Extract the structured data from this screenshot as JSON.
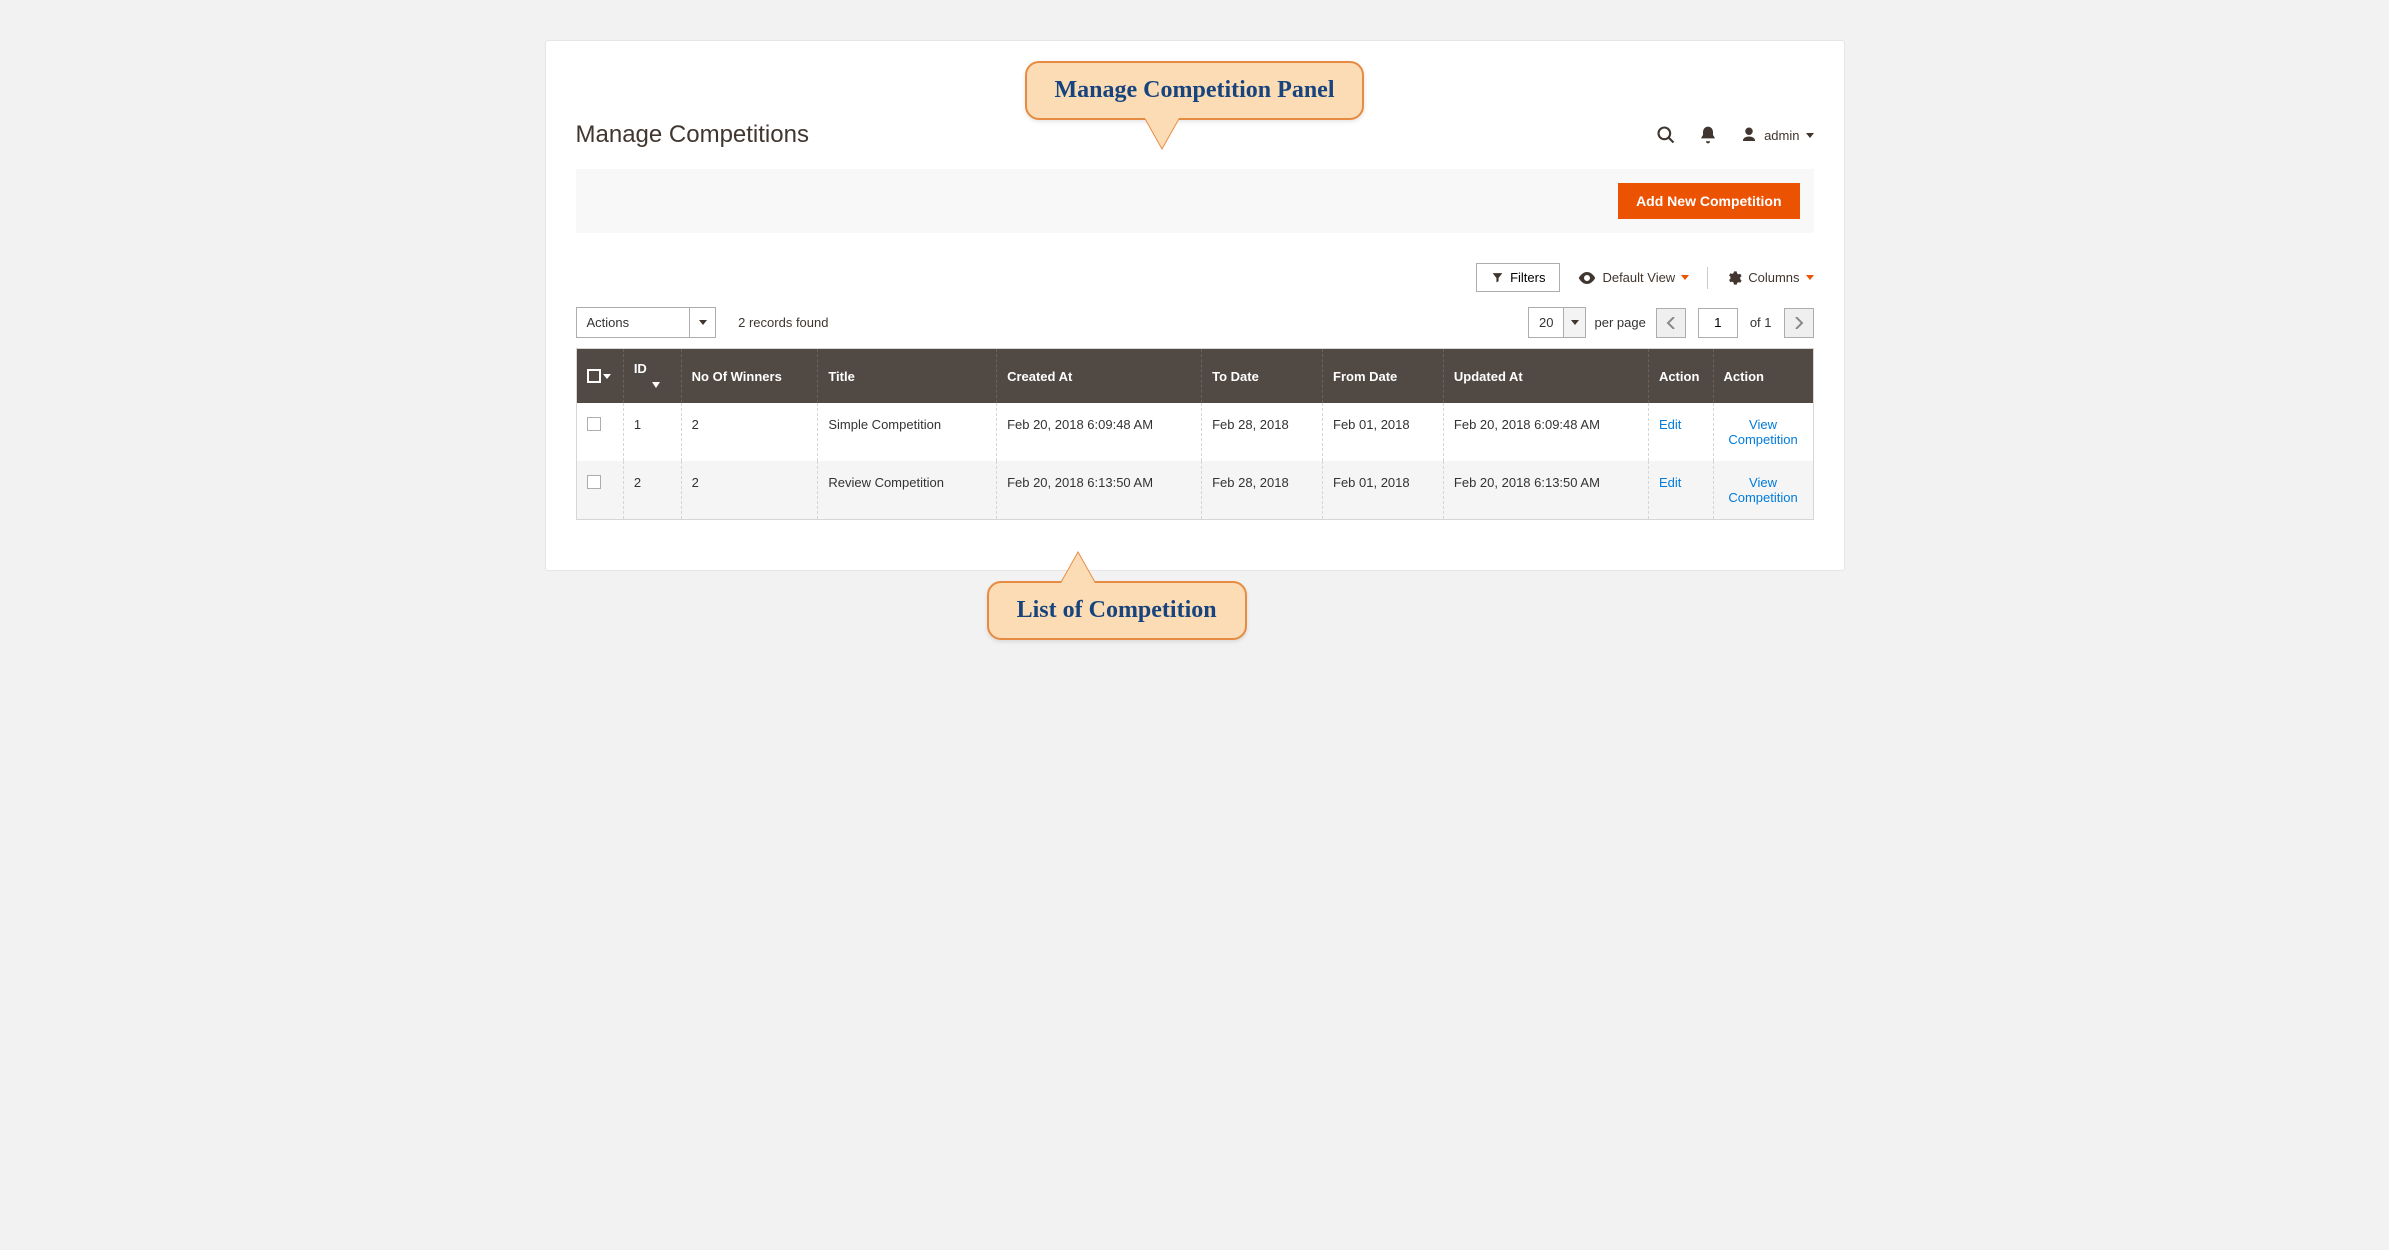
{
  "callouts": {
    "top": "Manage Competition Panel",
    "bottom": "List of Competition"
  },
  "header": {
    "title": "Manage Competitions",
    "user_label": "admin"
  },
  "actionbar": {
    "add_button": "Add New Competition"
  },
  "toolbar": {
    "filters": "Filters",
    "default_view": "Default View",
    "columns": "Columns"
  },
  "toolbar2": {
    "actions_label": "Actions",
    "records_found": "2 records found",
    "per_page_value": "20",
    "per_page_label": "per page",
    "page_current": "1",
    "page_of": "of 1"
  },
  "table": {
    "headers": {
      "id": "ID",
      "winners": "No Of Winners",
      "title": "Title",
      "created": "Created At",
      "to": "To Date",
      "from": "From Date",
      "updated": "Updated At",
      "action1": "Action",
      "action2": "Action"
    },
    "rows": [
      {
        "id": "1",
        "winners": "2",
        "title": "Simple Competition",
        "created": "Feb 20, 2018 6:09:48 AM",
        "to": "Feb 28, 2018",
        "from": "Feb 01, 2018",
        "updated": "Feb 20, 2018 6:09:48 AM",
        "edit": "Edit",
        "view": "View Competition"
      },
      {
        "id": "2",
        "winners": "2",
        "title": "Review Competition",
        "created": "Feb 20, 2018 6:13:50 AM",
        "to": "Feb 28, 2018",
        "from": "Feb 01, 2018",
        "updated": "Feb 20, 2018 6:13:50 AM",
        "edit": "Edit",
        "view": "View Competition"
      }
    ]
  }
}
